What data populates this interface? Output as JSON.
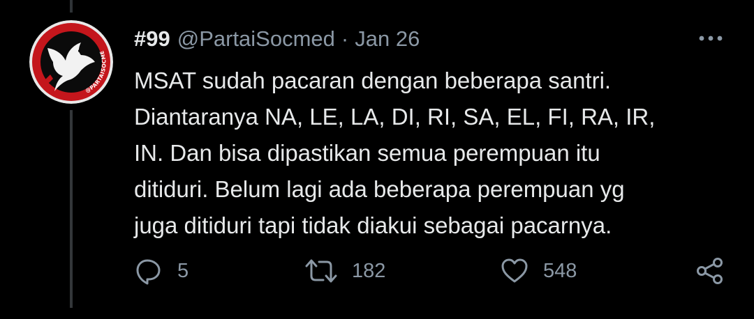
{
  "tweet": {
    "display_name": "#99",
    "handle": "@PartaiSocmed",
    "separator": "·",
    "date": "Jan 26",
    "avatar_text": "@PARTAISOCMED",
    "text_lines": [
      "MSAT sudah pacaran dengan beberapa santri.",
      "Diantaranya NA, LE, LA, DI, RI, SA, EL, FI, RA, IR,",
      "IN. Dan bisa dipastikan semua perempuan itu",
      "ditiduri. Belum lagi ada beberapa perempuan yg",
      "juga ditiduri tapi tidak diakui sebagai pacarnya."
    ]
  },
  "actions": {
    "reply": {
      "icon": "reply-icon",
      "count": "5"
    },
    "retweet": {
      "icon": "retweet-icon",
      "count": "182"
    },
    "like": {
      "icon": "heart-icon",
      "count": "548"
    },
    "share": {
      "icon": "share-icon"
    }
  },
  "more_icon": "more-horizontal-icon",
  "colors": {
    "background": "#000000",
    "primary_text": "#e7e9ea",
    "secondary_text": "#8b98a5",
    "avatar_red": "#c4161c",
    "thread_line": "#333639"
  }
}
